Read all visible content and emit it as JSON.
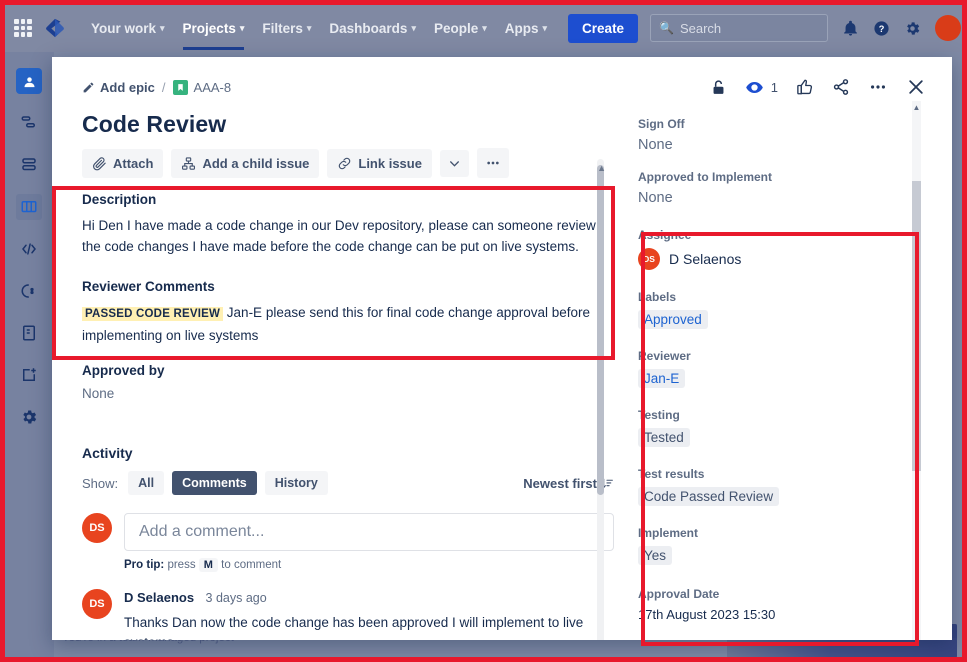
{
  "topnav": {
    "items": [
      {
        "label": "Your work",
        "has_caret": true,
        "active": false
      },
      {
        "label": "Projects",
        "has_caret": true,
        "active": true
      },
      {
        "label": "Filters",
        "has_caret": true,
        "active": false
      },
      {
        "label": "Dashboards",
        "has_caret": true,
        "active": false
      },
      {
        "label": "People",
        "has_caret": true,
        "active": false
      },
      {
        "label": "Apps",
        "has_caret": true,
        "active": false
      }
    ],
    "create_label": "Create",
    "search_placeholder": "Search",
    "icons": [
      "apps-grid-icon",
      "jira-logo-icon",
      "search-icon",
      "notifications-bell-icon",
      "help-icon",
      "settings-gear-icon",
      "profile-avatar"
    ]
  },
  "leftbar": {
    "items": [
      {
        "name": "project-avatar-icon",
        "active": false
      },
      {
        "name": "roadmap-icon",
        "active": false
      },
      {
        "name": "backlog-icon",
        "active": false
      },
      {
        "name": "board-icon",
        "active": true
      },
      {
        "name": "code-icon",
        "active": false
      },
      {
        "name": "releases-icon",
        "active": false
      },
      {
        "name": "project-pages-icon",
        "active": false
      },
      {
        "name": "add-shortcut-icon",
        "active": false
      },
      {
        "name": "project-settings-icon",
        "active": false
      }
    ]
  },
  "background": {
    "footer_note": "You're in a team-managed project"
  },
  "modal": {
    "breadcrumb": {
      "epic_label": "Add epic",
      "separator": "/",
      "issue_key": "AAA-8"
    },
    "header_actions": {
      "watch_count": "1",
      "icons": [
        "unlock-icon",
        "watch-eye-icon",
        "vote-thumbs-up-icon",
        "share-icon",
        "more-actions-icon",
        "close-icon"
      ]
    },
    "title": "Code Review",
    "toolbar": [
      {
        "label": "Attach",
        "icon": "attach-paperclip-icon"
      },
      {
        "label": "Add a child issue",
        "icon": "child-issue-icon"
      },
      {
        "label": "Link issue",
        "icon": "link-chain-icon"
      }
    ],
    "toolbar_extra": [
      {
        "icon": "chevron-down-icon"
      },
      {
        "icon": "more-options-icon"
      }
    ],
    "description": {
      "label": "Description",
      "text": "Hi Den I have made a code change in our Dev repository, please can someone review the code changes I have made before the code change can be put on live systems."
    },
    "reviewer_comments": {
      "label": "Reviewer Comments",
      "badge": "PASSED CODE REVIEW",
      "text": "Jan-E please send this for final code change approval before implementing on live systems"
    },
    "approved_by": {
      "label": "Approved by",
      "value": "None"
    },
    "activity": {
      "title": "Activity",
      "show_label": "Show:",
      "tabs": [
        {
          "label": "All",
          "active": false
        },
        {
          "label": "Comments",
          "active": true
        },
        {
          "label": "History",
          "active": false
        }
      ],
      "sort_label": "Newest first",
      "sort_icon": "sort-descending-icon",
      "comment_box": {
        "avatar_initials": "DS",
        "placeholder": "Add a comment...",
        "protip_prefix": "Pro tip:",
        "protip_mid": "press",
        "protip_key": "M",
        "protip_suffix": "to comment"
      },
      "comments": [
        {
          "avatar_initials": "DS",
          "author": "D Selaenos",
          "time": "3 days ago",
          "body": "Thanks Dan now the code change has been approved I will implement to live systems."
        }
      ]
    },
    "details": [
      {
        "name": "sign-off",
        "label": "Sign Off",
        "value": "None",
        "type": "none"
      },
      {
        "name": "approved-to-implement",
        "label": "Approved to Implement",
        "value": "None",
        "type": "none"
      },
      {
        "name": "assignee",
        "label": "Assignee",
        "value": "D Selaenos",
        "type": "user",
        "avatar_initials": "DS"
      },
      {
        "name": "labels",
        "label": "Labels",
        "value": "Approved",
        "type": "tag-link"
      },
      {
        "name": "reviewer",
        "label": "Reviewer",
        "value": "Jan-E",
        "type": "tag-link"
      },
      {
        "name": "testing",
        "label": "Testing",
        "value": "Tested",
        "type": "tag-grey"
      },
      {
        "name": "test-results",
        "label": "Test results",
        "value": "Code Passed Review",
        "type": "tag-grey"
      },
      {
        "name": "implement",
        "label": "Implement",
        "value": "Yes",
        "type": "tag-grey"
      },
      {
        "name": "approval-date",
        "label": "Approval Date",
        "value": "17th August 2023 15:30",
        "type": "text"
      }
    ]
  },
  "annotations": {
    "highlight_color": "#e8192c",
    "boxes": [
      "description-highlight",
      "details-fields-highlight",
      "screen-border-highlight"
    ]
  }
}
